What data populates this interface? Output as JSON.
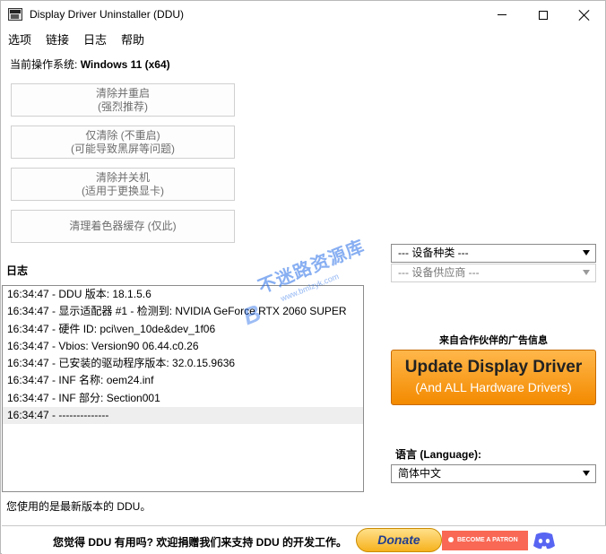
{
  "window": {
    "title": "Display Driver Uninstaller (DDU)"
  },
  "menu": [
    "选项",
    "链接",
    "日志",
    "帮助"
  ],
  "os": {
    "label": "当前操作系统:",
    "value": "Windows 11 (x64)"
  },
  "buttons": [
    {
      "line1": "清除并重启",
      "line2": "(强烈推荐)"
    },
    {
      "line1": "仅清除 (不重启)",
      "line2": "(可能导致黑屏等问题)"
    },
    {
      "line1": "清除并关机",
      "line2": "(适用于更换显卡)"
    },
    {
      "line1": "清理着色器缓存 (仅此)"
    }
  ],
  "log": {
    "label": "日志",
    "entries": [
      "16:34:47 - DDU 版本: 18.1.5.6",
      "16:34:47 - 显示适配器 #1 - 检测到: NVIDIA GeForce RTX 2060 SUPER",
      "16:34:47 - 硬件 ID: pci\\ven_10de&dev_1f06",
      "16:34:47 - Vbios: Version90 06.44.c0.26",
      "16:34:47 - 已安装的驱动程序版本: 32.0.15.9636",
      "16:34:47 - INF 名称: oem24.inf",
      "16:34:47 - INF 部分: Section001",
      "16:34:47 - --------------"
    ]
  },
  "status": "您使用的是最新版本的 DDU。",
  "device": {
    "type": "--- 设备种类 ---",
    "vendor": "--- 设备供应商 ---"
  },
  "ad": {
    "label": "来自合作伙伴的广告信息",
    "title": "Update Display Driver",
    "subtitle": "(And ALL Hardware Drivers)"
  },
  "language": {
    "label": "语言 (Language):",
    "value": "简体中文"
  },
  "footer": {
    "text": "您觉得 DDU 有用吗? 欢迎捐赠我们来支持 DDU 的开发工作。",
    "donate": "Donate",
    "patron": "BECOME A PATRON"
  },
  "watermark": {
    "main": "不迷路资源库",
    "url": "www.bmlzyk.com",
    "mark": "B"
  },
  "colors": {
    "ad_orange": "#f38a00",
    "patreon": "#f96854",
    "discord": "#5865f2",
    "donate_text": "#223e8e"
  }
}
